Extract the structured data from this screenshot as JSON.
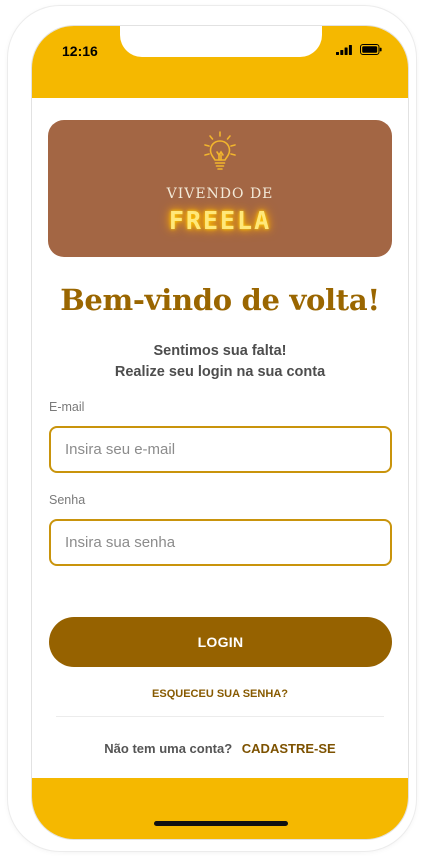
{
  "status_bar": {
    "time": "12:16",
    "icons": [
      "signal-icon",
      "battery-icon"
    ]
  },
  "logo": {
    "icon": "lightbulb-icon",
    "line1": "VIVENDO DE",
    "line2": "FREELA"
  },
  "header": {
    "title": "Bem-vindo de volta!",
    "subtitle_line1": "Sentimos sua falta!",
    "subtitle_line2": "Realize seu login na sua conta"
  },
  "form": {
    "email": {
      "label": "E-mail",
      "value": "",
      "placeholder": "Insira seu e-mail"
    },
    "password": {
      "label": "Senha",
      "value": "",
      "placeholder": "Insira sua senha"
    },
    "login_label": "LOGIN",
    "forgot_label": "ESQUECEU SUA SENHA?"
  },
  "footer": {
    "prompt": "Não tem uma conta?",
    "signup_label": "CADASTRE-SE"
  },
  "colors": {
    "accent_yellow": "#f5b800",
    "primary_brown": "#966200",
    "title_brown": "#9a6600",
    "logo_card": "#a36644",
    "input_border": "#c9940c"
  }
}
